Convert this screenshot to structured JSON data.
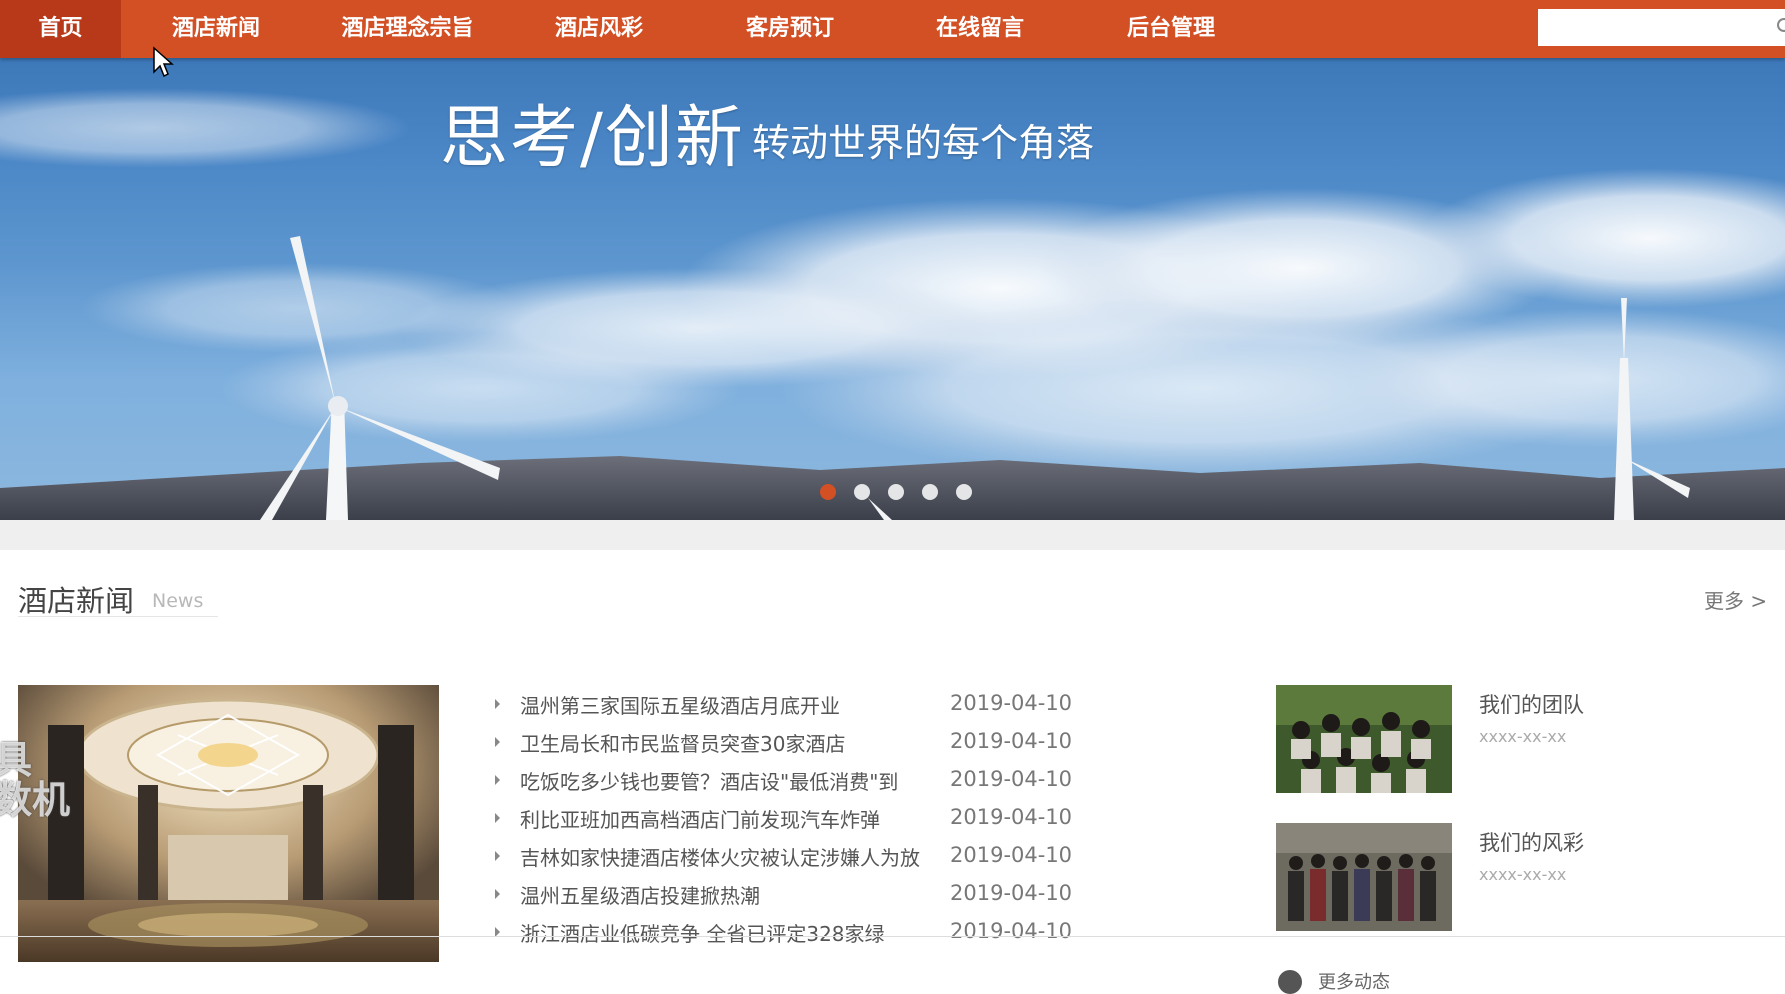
{
  "nav": {
    "items": [
      {
        "label": "首页",
        "active": true
      },
      {
        "label": "酒店新闻"
      },
      {
        "label": "酒店理念宗旨"
      },
      {
        "label": "酒店风彩"
      },
      {
        "label": "客房预订"
      },
      {
        "label": "在线留言"
      },
      {
        "label": "后台管理"
      }
    ],
    "search_placeholder": ""
  },
  "banner": {
    "title": "思考/创新",
    "subtitle": "转动世界的每个角落",
    "slide_count": 5,
    "active_slide": 1
  },
  "news_section": {
    "title": "酒店新闻",
    "title_en": "News",
    "more_label": "更多 >",
    "items": [
      {
        "title": "温州第三家国际五星级酒店月底开业",
        "date": "2019-04-10"
      },
      {
        "title": "卫生局长和市民监督员突查30家酒店",
        "date": "2019-04-10"
      },
      {
        "title": "吃饭吃多少钱也要管？酒店设\"最低消费\"到",
        "date": "2019-04-10"
      },
      {
        "title": "利比亚班加西高档酒店门前发现汽车炸弹",
        "date": "2019-04-10"
      },
      {
        "title": "吉林如家快捷酒店楼体火灾被认定涉嫌人为放",
        "date": "2019-04-10"
      },
      {
        "title": "温州五星级酒店投建掀热潮",
        "date": "2019-04-10"
      },
      {
        "title": "浙江酒店业低碳竞争 全省已评定328家绿",
        "date": "2019-04-10"
      }
    ],
    "side_cards": [
      {
        "title": "我们的团队",
        "date": "xxxx-xx-xx"
      },
      {
        "title": "我们的风彩",
        "date": "xxxx-xx-xx"
      }
    ],
    "partial_footer_text": "更多动态"
  },
  "colors": {
    "nav_bg": "#d34f24",
    "nav_active": "#b8391a",
    "dot_active": "#d34f24"
  }
}
